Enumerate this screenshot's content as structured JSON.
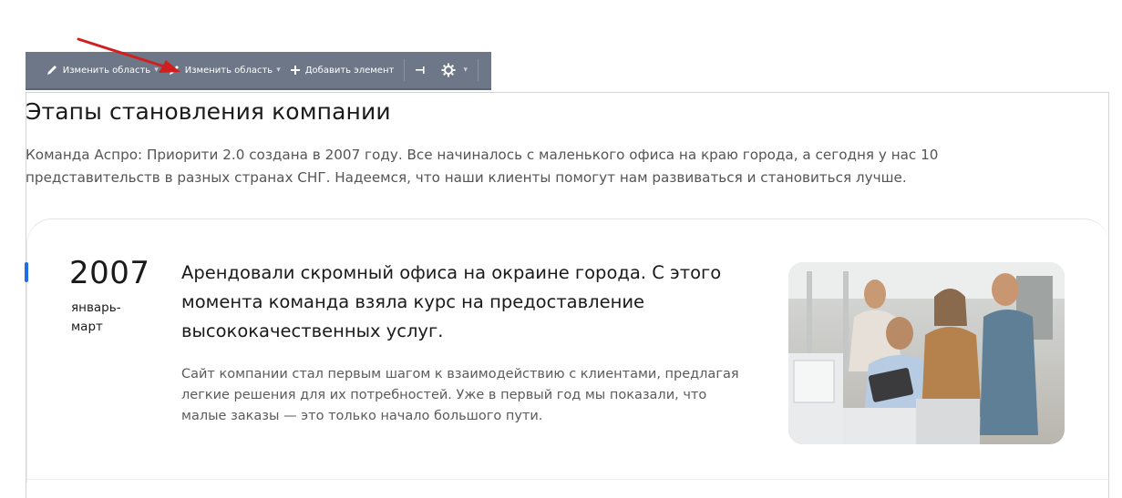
{
  "toolbar": {
    "edit_area_1": "Изменить область",
    "edit_area_2": "Изменить область",
    "add_element": "Добавить элемент"
  },
  "page": {
    "title": "Этапы становления компании",
    "intro": "Команда Аспро: Приорити 2.0 создана в 2007 году. Все начиналось с маленького офиса на краю города, а сегодня у нас 10 представительств в разных странах СНГ. Надеемся, что наши клиенты помогут нам развиваться и становиться лучше."
  },
  "timeline": {
    "year": "2007",
    "period": "январь-март",
    "headline": "Арендовали скромный офиса на окраине города. С этого момента команда взяла курс на предоставление высококачественных услуг.",
    "description": "Сайт компании стал первым шагом к взаимодействию с клиентами, предлагая легкие решения для их потребностей. Уже в первый год мы показали, что малые заказы — это только начало большого пути."
  },
  "colors": {
    "toolbar_bg": "#6e7787",
    "accent_blue": "#1e6ee8",
    "annotation_arrow": "#d01f1f"
  }
}
